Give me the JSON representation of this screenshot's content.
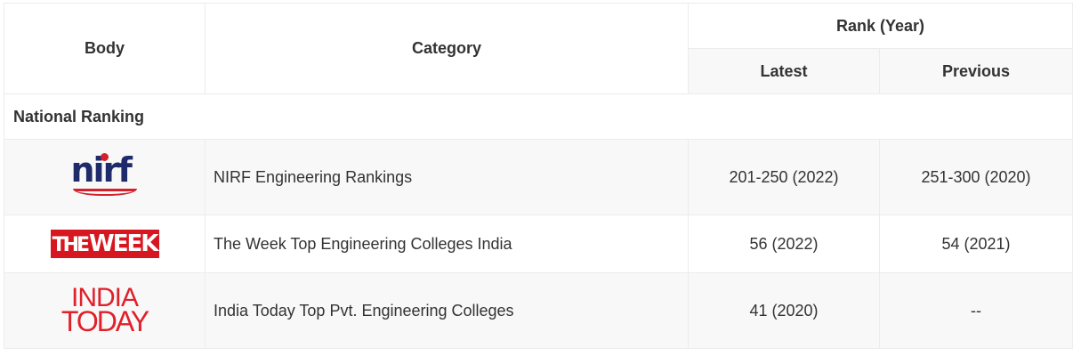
{
  "header": {
    "body": "Body",
    "category": "Category",
    "rank_year": "Rank (Year)",
    "latest": "Latest",
    "previous": "Previous"
  },
  "section": {
    "title": "National Ranking"
  },
  "rows": [
    {
      "logo": "nirf",
      "logo_text": "nirf",
      "category": "NIRF Engineering Rankings",
      "latest": "201-250 (2022)",
      "previous": "251-300 (2020)"
    },
    {
      "logo": "theweek",
      "logo_text": "THE WEEK",
      "logo_text_a": "THE",
      "logo_text_b": "WEEK",
      "category": "The Week Top Engineering Colleges India",
      "latest": "56 (2022)",
      "previous": "54 (2021)"
    },
    {
      "logo": "indiatoday",
      "logo_text_a": "INDIA",
      "logo_text_b": "TODAY",
      "category": "India Today Top Pvt. Engineering Colleges",
      "latest": "41 (2020)",
      "previous": "--"
    }
  ],
  "colors": {
    "header_sub_bg": "#f8f8f8",
    "border": "#ececec",
    "text": "#333333",
    "nirf_blue": "#1f2a6b",
    "brand_red": "#d7171f"
  }
}
